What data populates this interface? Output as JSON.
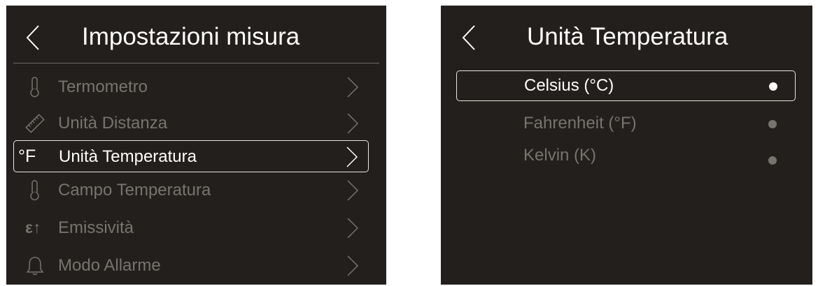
{
  "colors": {
    "background": "#231f1c",
    "text_active": "#ffffff",
    "text_inactive": "#77736f",
    "highlight_border": "#e9e6e2"
  },
  "left_screen": {
    "title": "Impostazioni misura",
    "items": [
      {
        "label": "Termometro",
        "icon": "thermometer-icon",
        "selected": false
      },
      {
        "label": "Unità Distanza",
        "icon": "ruler-icon",
        "selected": false
      },
      {
        "label": "Unità Temperatura",
        "icon": "unit-glyph",
        "icon_text": "°F",
        "selected": true
      },
      {
        "label": "Campo Temperatura",
        "icon": "thermometer-icon",
        "selected": false
      },
      {
        "label": "Emissività",
        "icon": "emissivity-glyph",
        "icon_text": "ε↑",
        "selected": false
      },
      {
        "label": "Modo Allarme",
        "icon": "bell-icon",
        "selected": false
      }
    ]
  },
  "right_screen": {
    "title": "Unità Temperatura",
    "options": [
      {
        "label": "Celsius (°C)",
        "selected": true
      },
      {
        "label": "Fahrenheit (°F)",
        "selected": false
      },
      {
        "label": "Kelvin (K)",
        "selected": false
      }
    ]
  }
}
